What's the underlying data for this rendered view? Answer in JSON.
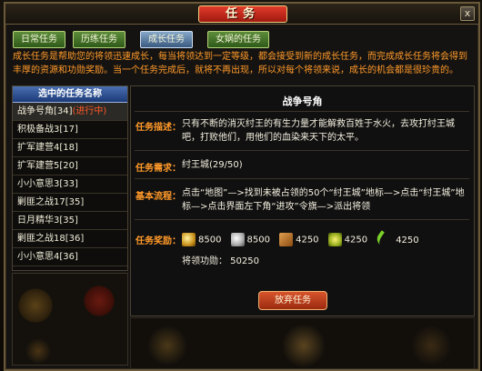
{
  "window": {
    "title": "任务",
    "close_label": "x"
  },
  "tabs": [
    {
      "label": "日常任务",
      "active": false
    },
    {
      "label": "历练任务",
      "active": false
    },
    {
      "label": "成长任务",
      "active": true
    },
    {
      "label": "女娲的任务",
      "active": false
    }
  ],
  "description": "成长任务是帮助您的将领迅速成长，每当将领达到一定等级，都会接受到新的成长任务，而完成成长任务将会得到丰厚的资源和功勋奖励。当一个任务完成后，就将不再出现，所以对每个将领来说，成长的机会都是很珍贵的。",
  "quest_list": {
    "header": "选中的任务名称",
    "items": [
      {
        "name": "战争号角[34]",
        "status": "(进行中)",
        "selected": true
      },
      {
        "name": "积极备战3[17]",
        "status": "",
        "selected": false
      },
      {
        "name": "扩军建营4[18]",
        "status": "",
        "selected": false
      },
      {
        "name": "扩军建营5[20]",
        "status": "",
        "selected": false
      },
      {
        "name": "小小意思3[33]",
        "status": "",
        "selected": false
      },
      {
        "name": "剿匪之战17[35]",
        "status": "",
        "selected": false
      },
      {
        "name": "日月精华3[35]",
        "status": "",
        "selected": false
      },
      {
        "name": "剿匪之战18[36]",
        "status": "",
        "selected": false
      },
      {
        "name": "小小意思4[36]",
        "status": "",
        "selected": false
      }
    ]
  },
  "detail": {
    "title": "战争号角",
    "desc_label": "任务描述：",
    "desc_text": "只有不断的消灭纣王的有生力量才能解救百姓于水火，去攻打纣王城吧，打败他们，用他们的血染来天下的太平。",
    "req_label": "任务需求：",
    "req_text": "纣王城(29/50)",
    "flow_label": "基本流程：",
    "flow_text": "点击“地图”—>找到未被占领的50个“纣王城”地标—>点击“纣王城”地标—>点击界面左下角“进攻”令旗—>派出将领",
    "reward_label": "任务奖励：",
    "rewards": [
      {
        "icon": "gold-icon",
        "value": "8500"
      },
      {
        "icon": "silver-icon",
        "value": "8500"
      },
      {
        "icon": "wood-icon",
        "value": "4250"
      },
      {
        "icon": "grain-icon",
        "value": "4250"
      },
      {
        "icon": "leaf-icon",
        "value": "4250"
      }
    ],
    "merit_text": "将领功勋：  50250",
    "abandon_button": "放弃任务"
  }
}
